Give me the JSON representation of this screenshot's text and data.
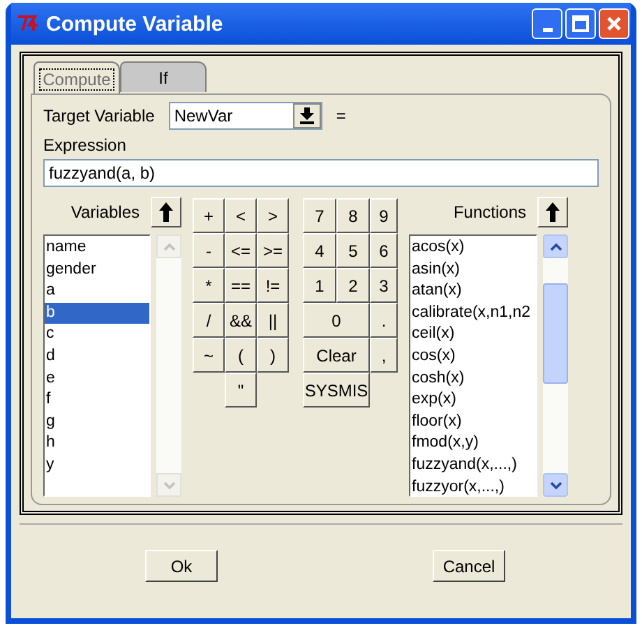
{
  "window": {
    "title": "Compute Variable"
  },
  "tabs": [
    {
      "label": "Compute",
      "selected": true
    },
    {
      "label": "If",
      "selected": false
    }
  ],
  "target": {
    "label": "Target Variable",
    "value": "NewVar",
    "equals": "="
  },
  "expression": {
    "label": "Expression",
    "value": "fuzzyand(a, b)"
  },
  "variables": {
    "heading": "Variables",
    "items": [
      {
        "label": "name",
        "selected": false
      },
      {
        "label": "gender",
        "selected": false
      },
      {
        "label": "a",
        "selected": false
      },
      {
        "label": "b",
        "selected": true
      },
      {
        "label": "c",
        "selected": false
      },
      {
        "label": "d",
        "selected": false
      },
      {
        "label": "e",
        "selected": false
      },
      {
        "label": "f",
        "selected": false
      },
      {
        "label": "g",
        "selected": false
      },
      {
        "label": "h",
        "selected": false
      },
      {
        "label": "y",
        "selected": false
      }
    ]
  },
  "operators": [
    [
      "+",
      "<",
      ">"
    ],
    [
      "-",
      "<=",
      ">="
    ],
    [
      "*",
      "==",
      "!="
    ],
    [
      "/",
      "&&",
      "||"
    ],
    [
      "~",
      "(",
      ")"
    ],
    [
      "\""
    ]
  ],
  "digits": [
    [
      {
        "label": "7",
        "kind": "key"
      },
      {
        "label": "8",
        "kind": "key"
      },
      {
        "label": "9",
        "kind": "key"
      }
    ],
    [
      {
        "label": "4",
        "kind": "key"
      },
      {
        "label": "5",
        "kind": "key"
      },
      {
        "label": "6",
        "kind": "key"
      }
    ],
    [
      {
        "label": "1",
        "kind": "key"
      },
      {
        "label": "2",
        "kind": "key"
      },
      {
        "label": "3",
        "kind": "key"
      }
    ],
    [
      {
        "label": "0",
        "kind": "wide"
      },
      {
        "label": ".",
        "kind": "key"
      }
    ],
    [
      {
        "label": "Clear",
        "kind": "wide"
      },
      {
        "label": ",",
        "kind": "key"
      }
    ],
    [
      {
        "label": "SYSMIS",
        "kind": "wide"
      }
    ]
  ],
  "functions": {
    "heading": "Functions",
    "items": [
      "acos(x)",
      "asin(x)",
      "atan(x)",
      "calibrate(x,n1,n2",
      "ceil(x)",
      "cos(x)",
      "cosh(x)",
      "exp(x)",
      "floor(x)",
      "fmod(x,y)",
      "fuzzyand(x,...,)",
      "fuzzyor(x,...,)"
    ]
  },
  "buttons": [
    "Ok",
    "Cancel"
  ]
}
